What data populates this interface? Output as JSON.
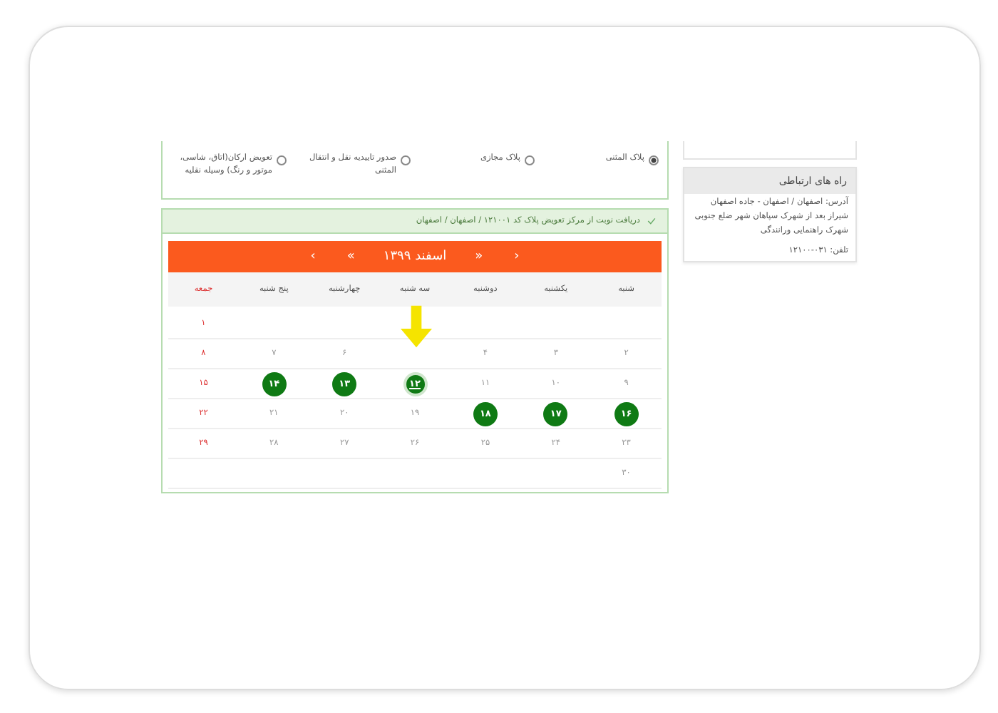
{
  "options": [
    {
      "label": "پلاک المثنی",
      "selected": true
    },
    {
      "label": "پلاک مجازی",
      "selected": false
    },
    {
      "label": "صدور تاییدیه نقل و انتقال المثنی",
      "selected": false
    },
    {
      "label": "تعویض ارکان(اتاق، شاسی، موتور و رنگ) وسیله نقلیه",
      "selected": false
    }
  ],
  "booking_header": "دریافت نوبت از مرکز تعویض پلاک کد ۱۲۱۰۰۱ / اصفهان / اصفهان",
  "calendar": {
    "prev_month": "‹",
    "prev_year": "«",
    "month": "اسفند ۱۳۹۹",
    "next_year": "»",
    "next_month": "›",
    "weekdays": [
      {
        "label": "شنبه",
        "holiday": false
      },
      {
        "label": "یکشنبه",
        "holiday": false
      },
      {
        "label": "دوشنبه",
        "holiday": false
      },
      {
        "label": "سه شنبه",
        "holiday": false
      },
      {
        "label": "چهارشنبه",
        "holiday": false
      },
      {
        "label": "پنج شنبه",
        "holiday": false
      },
      {
        "label": "جمعه",
        "holiday": true
      }
    ],
    "weeks": [
      [
        {
          "kind": "blank"
        },
        {
          "kind": "blank"
        },
        {
          "kind": "blank"
        },
        {
          "kind": "blank"
        },
        {
          "kind": "blank"
        },
        {
          "kind": "blank"
        },
        {
          "kind": "plain",
          "day": "۱",
          "selected": false
        }
      ],
      [
        {
          "kind": "plain",
          "day": "۲",
          "selected": false
        },
        {
          "kind": "plain",
          "day": "۳",
          "selected": false
        },
        {
          "kind": "plain",
          "day": "۴",
          "selected": false
        },
        {
          "kind": "blank"
        },
        {
          "kind": "plain",
          "day": "۶",
          "selected": false
        },
        {
          "kind": "plain",
          "day": "۷",
          "selected": false
        },
        {
          "kind": "plain",
          "day": "۸",
          "selected": false
        }
      ],
      [
        {
          "kind": "plain",
          "day": "۹",
          "selected": false
        },
        {
          "kind": "plain",
          "day": "۱۰",
          "selected": false
        },
        {
          "kind": "plain",
          "day": "۱۱",
          "selected": false
        },
        {
          "kind": "available",
          "day": "۱۲",
          "selected": true
        },
        {
          "kind": "available",
          "day": "۱۳",
          "selected": false
        },
        {
          "kind": "available",
          "day": "۱۴",
          "selected": false
        },
        {
          "kind": "plain",
          "day": "۱۵",
          "selected": false
        }
      ],
      [
        {
          "kind": "available",
          "day": "۱۶",
          "selected": false
        },
        {
          "kind": "available",
          "day": "۱۷",
          "selected": false
        },
        {
          "kind": "available",
          "day": "۱۸",
          "selected": false
        },
        {
          "kind": "plain",
          "day": "۱۹",
          "selected": false
        },
        {
          "kind": "plain",
          "day": "۲۰",
          "selected": false
        },
        {
          "kind": "plain",
          "day": "۲۱",
          "selected": false
        },
        {
          "kind": "plain",
          "day": "۲۲",
          "selected": false
        }
      ],
      [
        {
          "kind": "plain",
          "day": "۲۳",
          "selected": false
        },
        {
          "kind": "plain",
          "day": "۲۴",
          "selected": false
        },
        {
          "kind": "plain",
          "day": "۲۵",
          "selected": false
        },
        {
          "kind": "plain",
          "day": "۲۶",
          "selected": false
        },
        {
          "kind": "plain",
          "day": "۲۷",
          "selected": false
        },
        {
          "kind": "plain",
          "day": "۲۸",
          "selected": false
        },
        {
          "kind": "plain",
          "day": "۲۹",
          "selected": false
        }
      ],
      [
        {
          "kind": "plain",
          "day": "۳۰",
          "selected": false
        },
        {
          "kind": "blank"
        },
        {
          "kind": "blank"
        },
        {
          "kind": "blank"
        },
        {
          "kind": "blank"
        },
        {
          "kind": "blank"
        },
        {
          "kind": "blank"
        }
      ]
    ]
  },
  "contact": {
    "title": "راه های ارتباطی",
    "address": "آدرس: اصفهان / اصفهان - جاده اصفهان شیراز بعد از شهرک سپاهان شهر ضلع جنوبی شهرک راهنمایی ورانندگی",
    "phone": "تلفن: ۰۳۱-۱۲۱۰۰"
  }
}
